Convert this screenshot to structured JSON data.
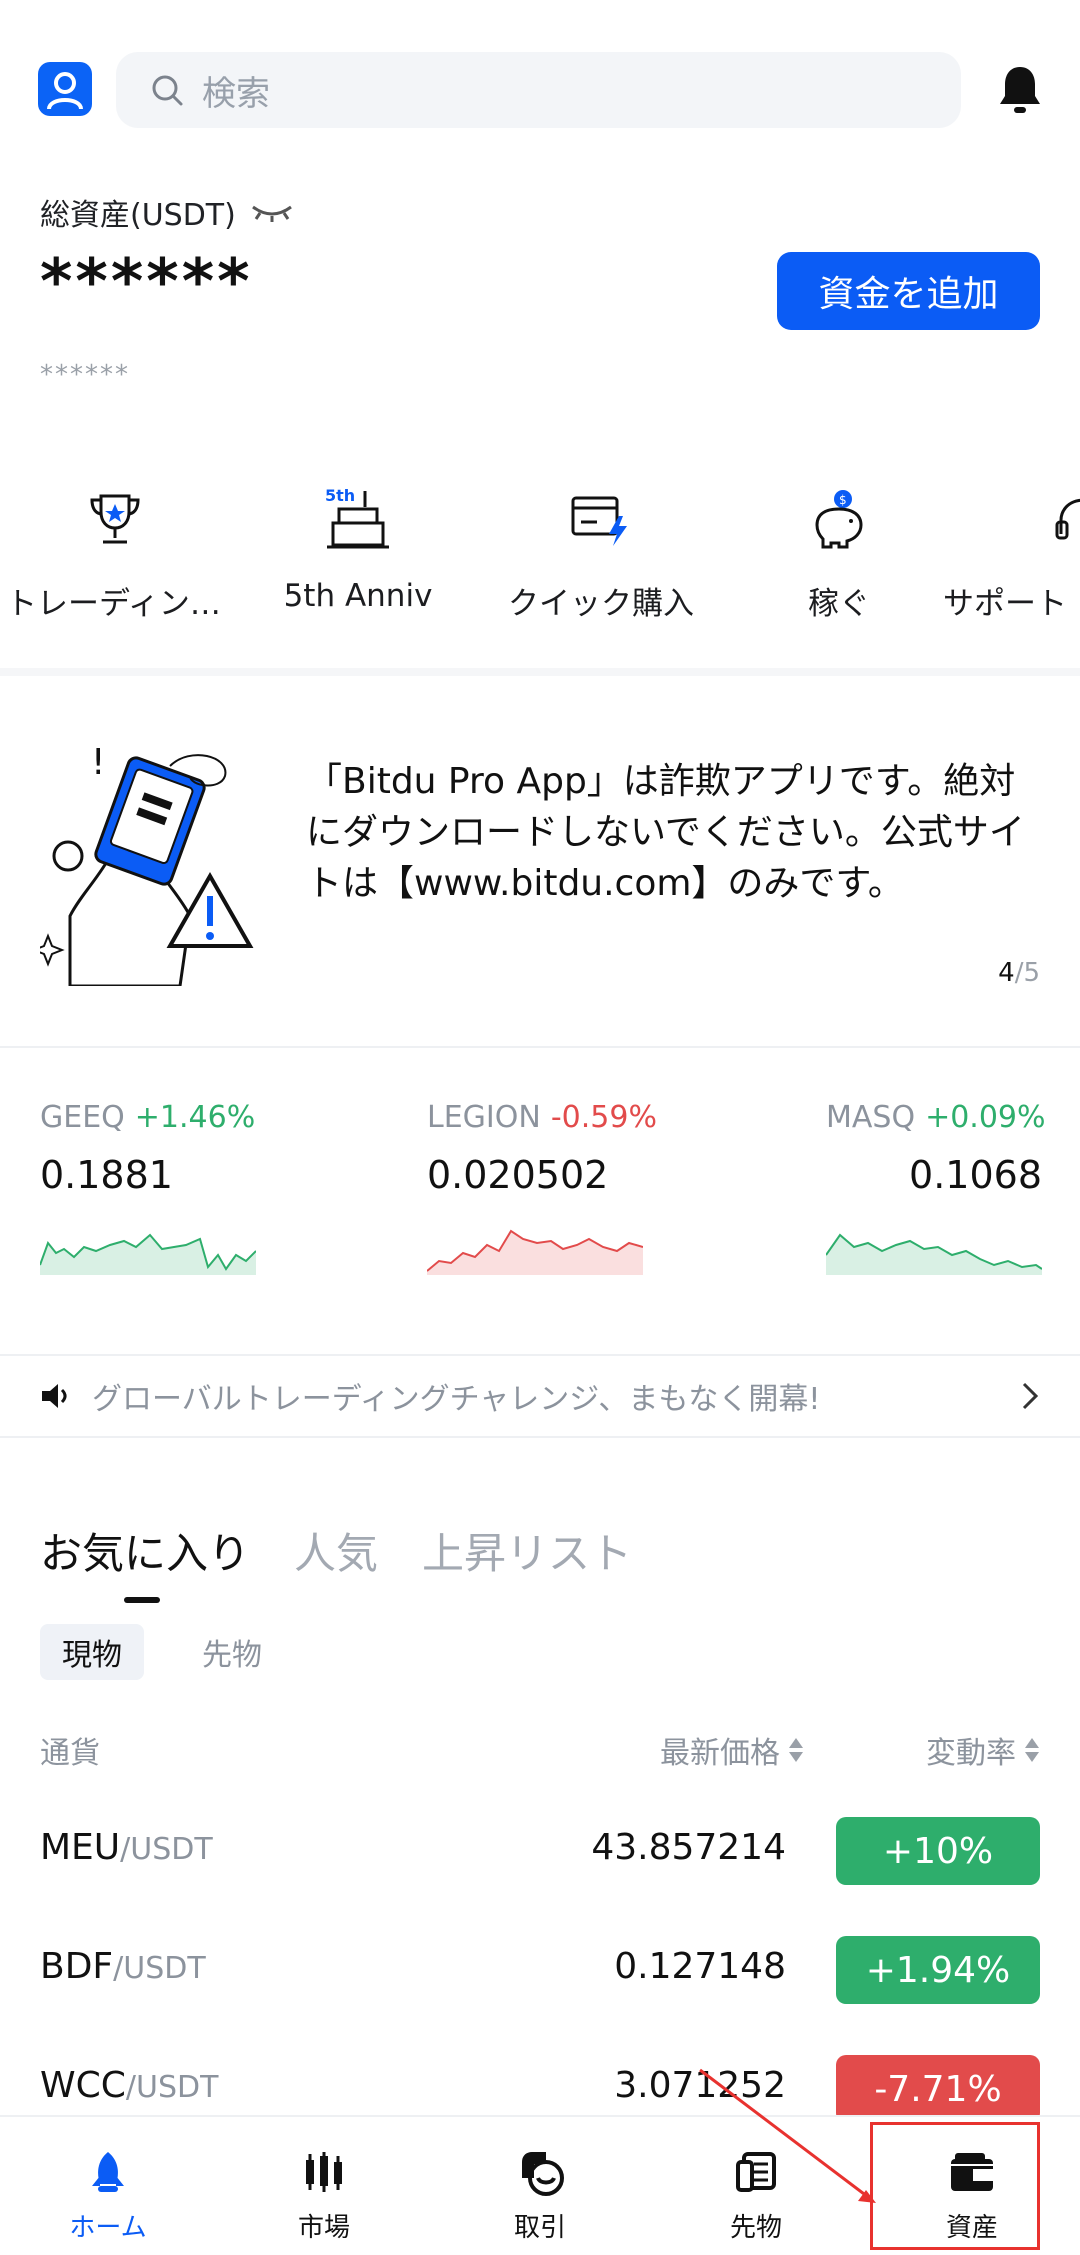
{
  "search": {
    "placeholder": "検索"
  },
  "assets": {
    "label": "総資産(USDT)",
    "value": "******",
    "sub_value": "******",
    "add_funds_label": "資金を追加"
  },
  "shortcuts": [
    {
      "label": "トレーディン…",
      "icon": "trophy-icon"
    },
    {
      "label": "5th Anniv",
      "icon": "cake-icon",
      "badge": "5th"
    },
    {
      "label": "クイック購入",
      "icon": "card-icon"
    },
    {
      "label": "稼ぐ",
      "icon": "piggy-bank-icon"
    },
    {
      "label": "サポート",
      "icon": "support-icon"
    }
  ],
  "banner": {
    "text": "「Bitdu Pro App」は詐欺アプリです。絶対にダウンロードしないでください。公式サイトは【www.bitdu.com】のみです。",
    "page_current": "4",
    "page_total": "/5"
  },
  "tickers": [
    {
      "symbol": "GEEQ",
      "change": "+1.46%",
      "price": "0.1881",
      "direction": "up"
    },
    {
      "symbol": "LEGION",
      "change": "-0.59%",
      "price": "0.020502",
      "direction": "down"
    },
    {
      "symbol": "MASQ",
      "change": "+0.09%",
      "price": "0.1068",
      "direction": "up"
    }
  ],
  "announcement": {
    "text": "グローバルトレーディングチャレンジ、まもなく開幕!"
  },
  "tabs": {
    "favorites": "お気に入り",
    "popular": "人気",
    "gainers": "上昇リスト"
  },
  "subtabs": {
    "spot": "現物",
    "futures": "先物"
  },
  "table": {
    "col_currency": "通貨",
    "col_last_price": "最新価格",
    "col_change": "変動率",
    "rows": [
      {
        "base": "MEU",
        "quote": "/USDT",
        "price": "43.857214",
        "change": "+10%",
        "direction": "up"
      },
      {
        "base": "BDF",
        "quote": "/USDT",
        "price": "0.127148",
        "change": "+1.94%",
        "direction": "up"
      },
      {
        "base": "WCC",
        "quote": "/USDT",
        "price": "3.071252",
        "change": "-7.71%",
        "direction": "down"
      }
    ]
  },
  "nav": [
    {
      "label": "ホーム",
      "icon": "home-rocket-icon",
      "active": true
    },
    {
      "label": "市場",
      "icon": "market-candles-icon"
    },
    {
      "label": "取引",
      "icon": "trade-icon"
    },
    {
      "label": "先物",
      "icon": "futures-icon"
    },
    {
      "label": "資産",
      "icon": "wallet-icon"
    }
  ],
  "colors": {
    "brand": "#0B5CF5",
    "up": "#2EAE6C",
    "down": "#E24B4B",
    "highlight": "#E8322F"
  }
}
